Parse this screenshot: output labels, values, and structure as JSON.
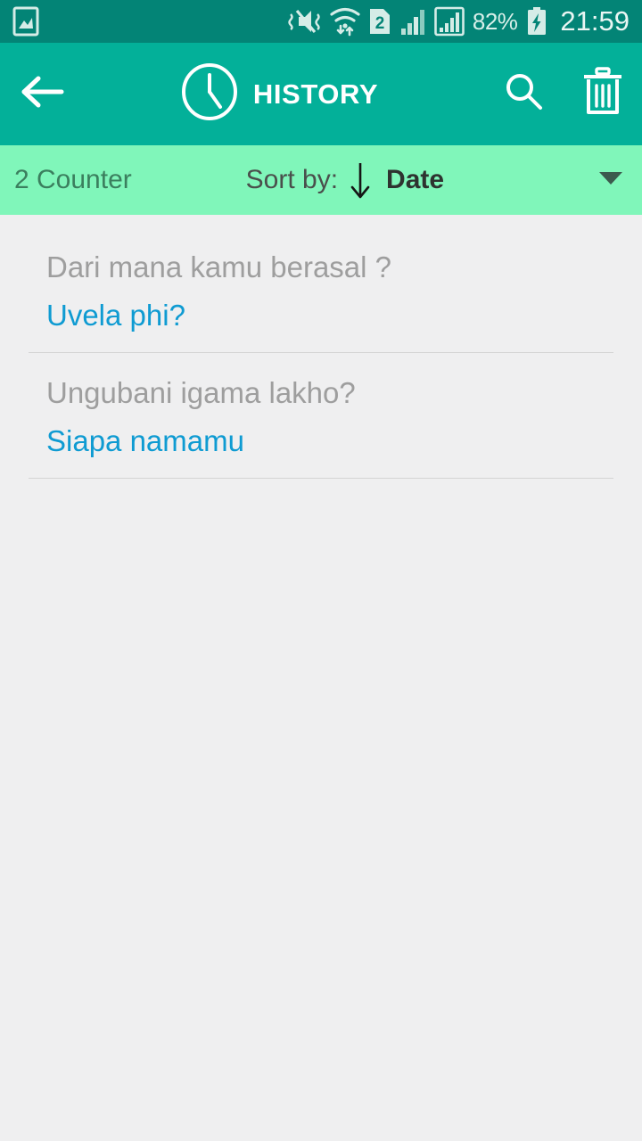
{
  "statusbar": {
    "icons": [
      "screenshot-image-icon",
      "vibrate-mute-icon",
      "wifi-data-transfer-icon",
      "sim2-icon",
      "signal-bars-1-icon",
      "signal-bars-2-icon"
    ],
    "battery_percent": "82%",
    "battery_state": "charging",
    "time": "21:59",
    "bg_color": "#038476",
    "text_color": "#dcf0eb"
  },
  "appbar": {
    "back_icon": "arrow-left-icon",
    "title_icon": "clock-icon",
    "title": "HISTORY",
    "search_icon": "search-icon",
    "delete_icon": "trash-icon",
    "bg_color": "#03b099",
    "text_color": "#ffffff"
  },
  "sortbar": {
    "counter": "2 Counter",
    "sort_by_label": "Sort by:",
    "sort_direction_icon": "arrow-down-icon",
    "sort_value": "Date",
    "dropdown_icon": "caret-down-icon",
    "bg_color": "#80f6ba",
    "counter_color": "#3b7f5e",
    "value_color": "#2e3330"
  },
  "history": {
    "items": [
      {
        "source_text": "Dari mana kamu berasal ?",
        "target_text": "Uvela phi?"
      },
      {
        "source_text": "Ungubani igama lakho?",
        "target_text": "Siapa namamu"
      }
    ],
    "source_color": "#9e9e9e",
    "target_color": "#0f9bd2",
    "background_color": "#efeff0"
  }
}
